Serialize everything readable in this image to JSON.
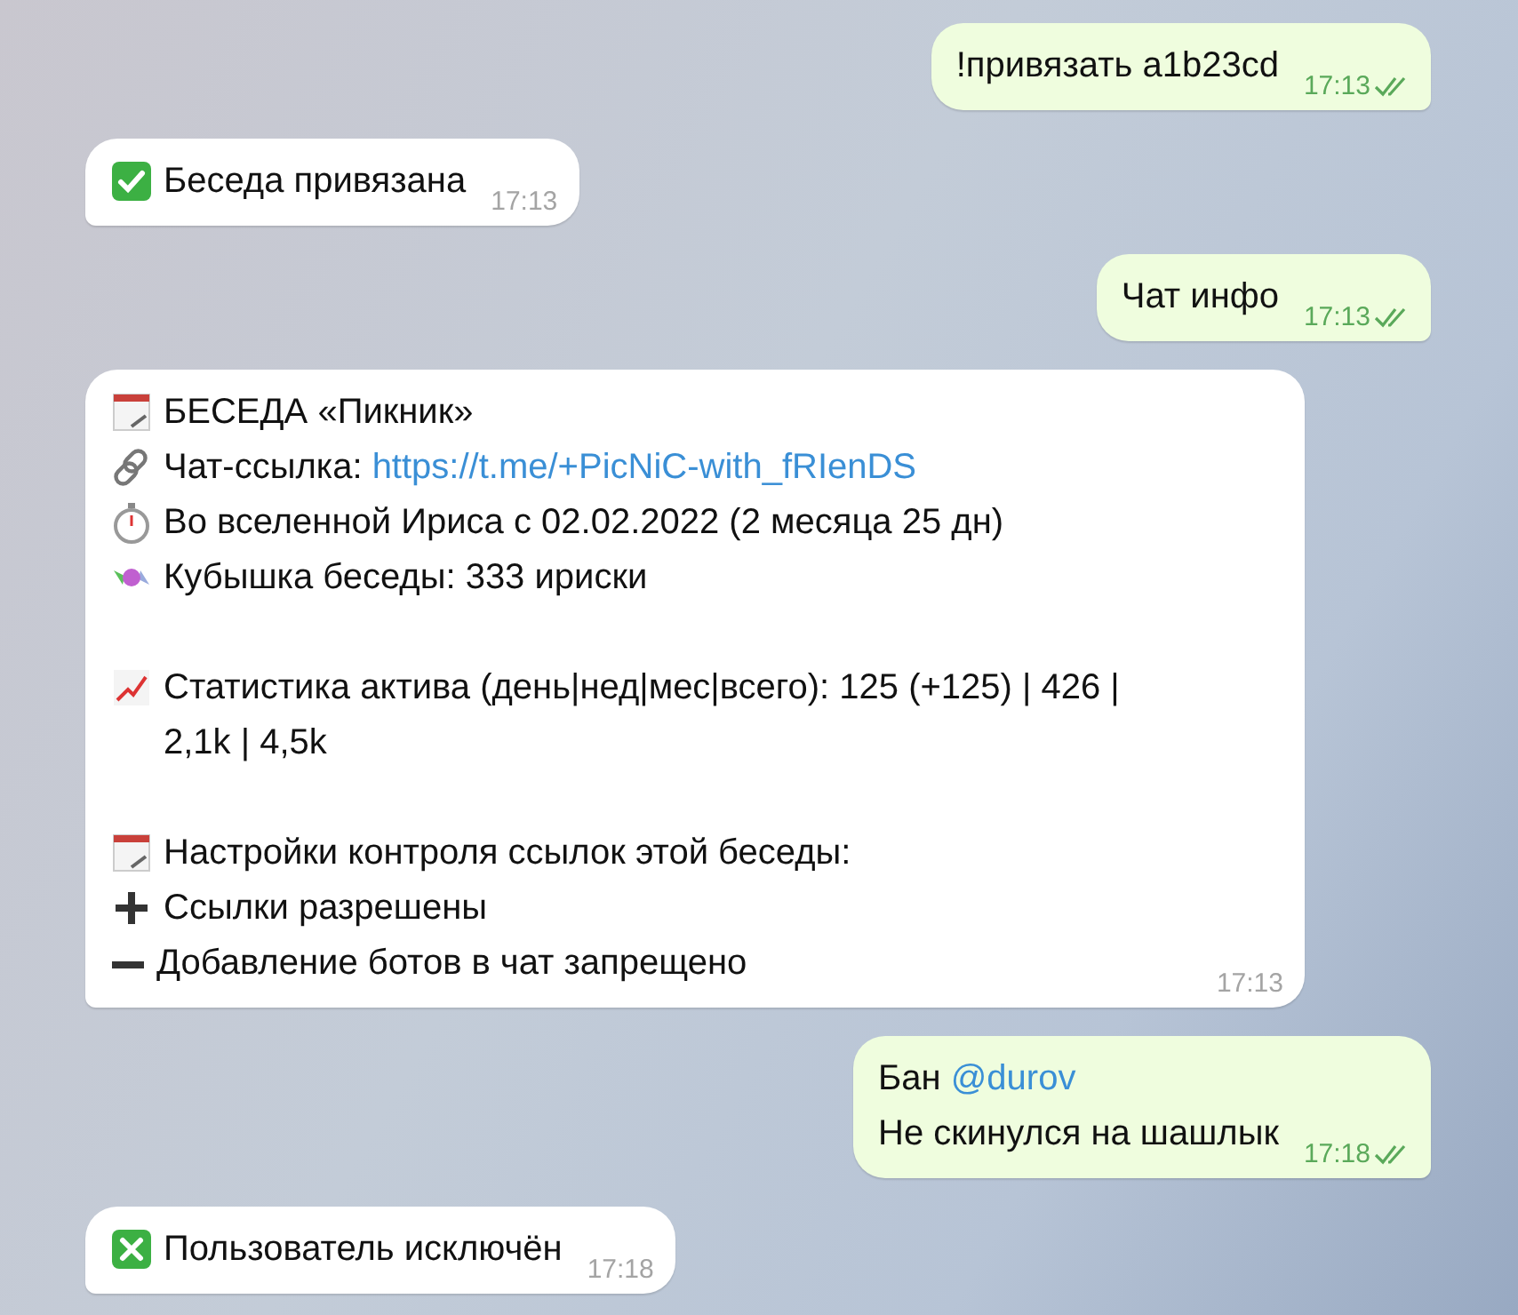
{
  "messages": [
    {
      "outgoing": true,
      "read": true,
      "time": "17:13",
      "lines": [
        {
          "text": "!привязать a1b23cd"
        }
      ]
    },
    {
      "outgoing": false,
      "time": "17:13",
      "lines": [
        {
          "kind": "success",
          "text": "Беседа привязана"
        }
      ]
    },
    {
      "outgoing": true,
      "read": true,
      "time": "17:13",
      "lines": [
        {
          "text": "Чат инфо"
        }
      ]
    },
    {
      "outgoing": false,
      "time": "17:13",
      "lines": [
        {
          "kind": "calendar",
          "text": "БЕСЕДА «Пикник»"
        },
        {
          "kind": "link",
          "text": "Чат-ссылка:",
          "link": "https://t.me/+PicNiC-with_fRIenDS"
        },
        {
          "kind": "timer",
          "text": "Во вселенной Ириса с 02.02.2022 (2 месяца 25 дн)"
        },
        {
          "kind": "candy",
          "text": "Кубышка беседы: 333 ириски"
        },
        {
          "kind": "chart",
          "gap_before": true,
          "text": "Статистика актива (день|нед|мес|всего): 125 (+125) | 426 | 2,1k | 4,5k"
        },
        {
          "kind": "calendar",
          "gap_before": true,
          "text": "Настройки контроля ссылок этой беседы:"
        },
        {
          "kind": "plus",
          "text": "Ссылки разрешены"
        },
        {
          "kind": "minus",
          "text": "Добавление ботов в чат запрещено"
        }
      ]
    },
    {
      "outgoing": true,
      "read": true,
      "time": "17:18",
      "lines": [
        {
          "text": "Бан",
          "link": "@durov"
        },
        {
          "text": "Не скинулся на шашлык"
        }
      ]
    },
    {
      "outgoing": false,
      "time": "17:18",
      "lines": [
        {
          "kind": "error",
          "text": "Пользователь исключён"
        }
      ]
    }
  ]
}
